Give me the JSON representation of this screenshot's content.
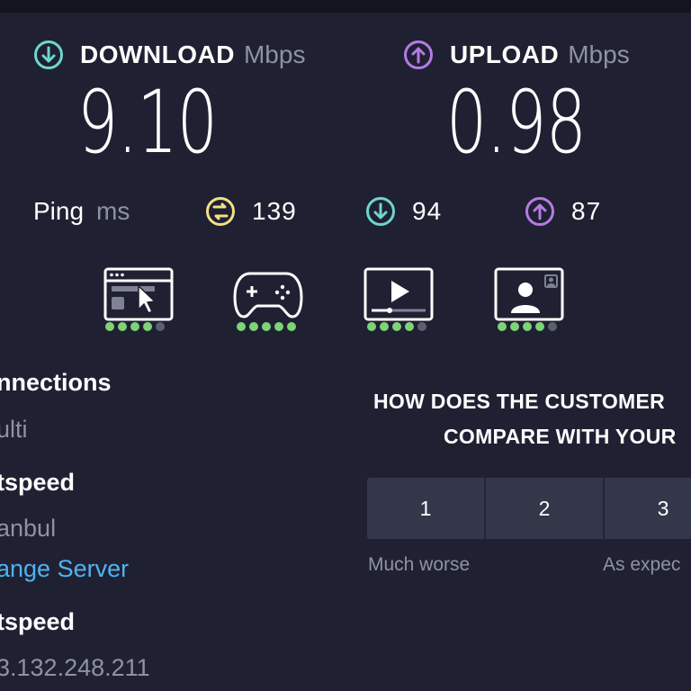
{
  "download": {
    "label": "DOWNLOAD",
    "unit": "Mbps",
    "value": "9.10",
    "icon": "arrow-down-circle-icon",
    "color": "#6fd6cc"
  },
  "upload": {
    "label": "UPLOAD",
    "unit": "Mbps",
    "value": "0.98",
    "icon": "arrow-up-circle-icon",
    "color": "#b77ae6"
  },
  "ping": {
    "label": "Ping",
    "unit": "ms",
    "idle": {
      "value": "139",
      "icon": "latency-icon",
      "color": "#f4e083"
    },
    "download": {
      "value": "94",
      "icon": "arrow-down-circle-icon",
      "color": "#6fd6cc"
    },
    "upload": {
      "value": "87",
      "icon": "arrow-up-circle-icon",
      "color": "#b77ae6"
    }
  },
  "quality": [
    {
      "icon": "web-browsing-icon",
      "rating": 4,
      "max": 5
    },
    {
      "icon": "gamepad-icon",
      "rating": 5,
      "max": 5
    },
    {
      "icon": "video-streaming-icon",
      "rating": 4,
      "max": 5
    },
    {
      "icon": "video-call-icon",
      "rating": 4,
      "max": 5
    }
  ],
  "info": {
    "connections_title": "nnections",
    "connections_value": "ulti",
    "server_title": "tspeed",
    "server_location": "anbul",
    "change_server_link": "ange Server",
    "provider_title": "tspeed",
    "ip_address": "3.132.248.211"
  },
  "survey": {
    "question_line1": "HOW DOES THE CUSTOMER",
    "question_line2": "COMPARE WITH YOUR",
    "options": [
      "1",
      "2",
      "3"
    ],
    "caption_low": "Much worse",
    "caption_mid": "As expec"
  },
  "colors": {
    "background": "#1f2133",
    "accent_green": "#7ed377",
    "link_blue": "#4fb3f0"
  }
}
